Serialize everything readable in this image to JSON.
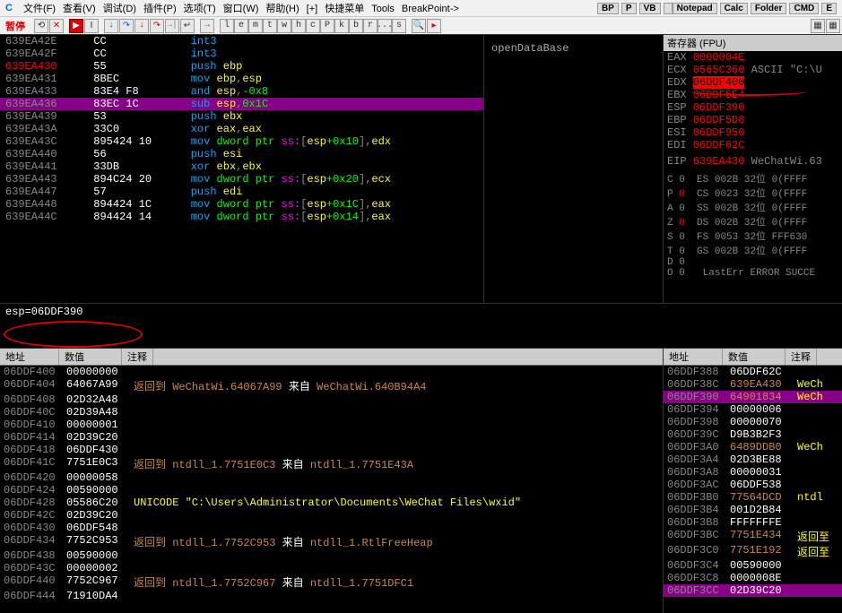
{
  "menu": [
    "文件(F)",
    "查看(V)",
    "调试(D)",
    "插件(P)",
    "选项(T)",
    "窗口(W)",
    "帮助(H)",
    "[+]",
    "快捷菜单",
    "Tools",
    "BreakPoint->"
  ],
  "menu_right": [
    "BP",
    "P",
    "VB",
    "",
    "Notepad",
    "Calc",
    "Folder",
    "CMD",
    "E"
  ],
  "toolbar": {
    "pause": "暂停",
    "letters": [
      "l",
      "e",
      "m",
      "t",
      "w",
      "h",
      "c",
      "P",
      "k",
      "b",
      "r",
      "...",
      "s"
    ]
  },
  "disasm": [
    {
      "addr": "639EA42E",
      "bytes": "CC",
      "mn": "int3",
      "ops": []
    },
    {
      "addr": "639EA42F",
      "bytes": "CC",
      "mn": "int3",
      "ops": []
    },
    {
      "addr": "639EA430",
      "hl": true,
      "bytes": "55",
      "mn": "push",
      "ops": [
        {
          "t": "reg",
          "v": "ebp"
        }
      ]
    },
    {
      "addr": "639EA431",
      "bytes": "8BEC",
      "mn": "mov",
      "ops": [
        {
          "t": "reg",
          "v": "ebp"
        },
        {
          "t": "comma"
        },
        {
          "t": "reg",
          "v": "esp"
        }
      ]
    },
    {
      "addr": "639EA433",
      "bytes": "83E4 F8",
      "mn": "and",
      "ops": [
        {
          "t": "reg",
          "v": "esp"
        },
        {
          "t": "comma"
        },
        {
          "t": "num",
          "v": "-0x8"
        }
      ]
    },
    {
      "addr": "639EA436",
      "sel": true,
      "bytes": "83EC 1C",
      "mn": "sub",
      "ops": [
        {
          "t": "reg",
          "v": "esp"
        },
        {
          "t": "comma"
        },
        {
          "t": "num",
          "v": "0x1C"
        }
      ]
    },
    {
      "addr": "639EA439",
      "bytes": "53",
      "mn": "push",
      "ops": [
        {
          "t": "reg",
          "v": "ebx"
        }
      ]
    },
    {
      "addr": "639EA43A",
      "bytes": "33C0",
      "mn": "xor",
      "ops": [
        {
          "t": "reg",
          "v": "eax"
        },
        {
          "t": "comma"
        },
        {
          "t": "reg",
          "v": "eax"
        }
      ]
    },
    {
      "addr": "639EA43C",
      "bytes": "895424 10",
      "mn": "mov",
      "ops": [
        {
          "t": "ptr",
          "v": "dword ptr "
        },
        {
          "t": "seg",
          "v": "ss"
        },
        {
          "t": "txt",
          "v": ":["
        },
        {
          "t": "reg",
          "v": "esp"
        },
        {
          "t": "num",
          "v": "+0x10"
        },
        {
          "t": "txt",
          "v": "],"
        },
        {
          "t": "reg",
          "v": "edx"
        }
      ]
    },
    {
      "addr": "639EA440",
      "bytes": "56",
      "mn": "push",
      "ops": [
        {
          "t": "reg",
          "v": "esi"
        }
      ]
    },
    {
      "addr": "639EA441",
      "bytes": "33DB",
      "mn": "xor",
      "ops": [
        {
          "t": "reg",
          "v": "ebx"
        },
        {
          "t": "comma"
        },
        {
          "t": "reg",
          "v": "ebx"
        }
      ]
    },
    {
      "addr": "639EA443",
      "bytes": "894C24 20",
      "mn": "mov",
      "ops": [
        {
          "t": "ptr",
          "v": "dword ptr "
        },
        {
          "t": "seg",
          "v": "ss"
        },
        {
          "t": "txt",
          "v": ":["
        },
        {
          "t": "reg",
          "v": "esp"
        },
        {
          "t": "num",
          "v": "+0x20"
        },
        {
          "t": "txt",
          "v": "],"
        },
        {
          "t": "reg",
          "v": "ecx"
        }
      ]
    },
    {
      "addr": "639EA447",
      "bytes": "57",
      "mn": "push",
      "ops": [
        {
          "t": "reg",
          "v": "edi"
        }
      ]
    },
    {
      "addr": "639EA448",
      "bytes": "894424 1C",
      "mn": "mov",
      "ops": [
        {
          "t": "ptr",
          "v": "dword ptr "
        },
        {
          "t": "seg",
          "v": "ss"
        },
        {
          "t": "txt",
          "v": ":["
        },
        {
          "t": "reg",
          "v": "esp"
        },
        {
          "t": "num",
          "v": "+0x1C"
        },
        {
          "t": "txt",
          "v": "],"
        },
        {
          "t": "reg",
          "v": "eax"
        }
      ]
    },
    {
      "addr": "639EA44C",
      "bytes": "894424 14",
      "mn": "mov",
      "ops": [
        {
          "t": "ptr",
          "v": "dword ptr "
        },
        {
          "t": "seg",
          "v": "ss"
        },
        {
          "t": "txt",
          "v": ":["
        },
        {
          "t": "reg",
          "v": "esp"
        },
        {
          "t": "num",
          "v": "+0x14"
        },
        {
          "t": "txt",
          "v": "],"
        },
        {
          "t": "reg",
          "v": "eax"
        }
      ]
    }
  ],
  "info": "openDataBase",
  "registers": {
    "title": "寄存器 (FPU)",
    "rows": [
      {
        "n": "EAX",
        "v": "0000004E",
        "c": ""
      },
      {
        "n": "ECX",
        "v": "0565C360",
        "c": "ASCII \"C:\\U"
      },
      {
        "n": "EDX",
        "v": "06DDF400",
        "hl": true,
        "c": ""
      },
      {
        "n": "EBX",
        "v": "06DDF5E4",
        "c": ""
      },
      {
        "n": "ESP",
        "v": "06DDF390",
        "c": ""
      },
      {
        "n": "EBP",
        "v": "06DDF5D8",
        "c": ""
      },
      {
        "n": "ESI",
        "v": "06DDF950",
        "c": ""
      },
      {
        "n": "EDI",
        "v": "06DDF62C",
        "c": ""
      }
    ],
    "eip": {
      "n": "EIP",
      "v": "639EA430",
      "c": "WeChatWi.63"
    },
    "flags": [
      {
        "f": "C",
        "v": "0",
        "s": "ES",
        "sv": "002B",
        "b": "32位",
        "x": "0(FFFF"
      },
      {
        "f": "P",
        "v": "0",
        "red": true,
        "s": "CS",
        "sv": "0023",
        "b": "32位",
        "x": "0(FFFF"
      },
      {
        "f": "A",
        "v": "0",
        "s": "SS",
        "sv": "002B",
        "b": "32位",
        "x": "0(FFFF"
      },
      {
        "f": "Z",
        "v": "0",
        "red": true,
        "s": "DS",
        "sv": "002B",
        "b": "32位",
        "x": "0(FFFF"
      },
      {
        "f": "S",
        "v": "0",
        "s": "FS",
        "sv": "0053",
        "b": "32位",
        "x": "FFF630"
      },
      {
        "f": "T",
        "v": "0",
        "s": "GS",
        "sv": "002B",
        "b": "32位",
        "x": "0(FFFF"
      },
      {
        "f": "D",
        "v": "0",
        "s": "",
        "sv": "",
        "b": "",
        "x": ""
      },
      {
        "f": "O",
        "v": "0",
        "s": "",
        "sv": "LastErr",
        "b": "ERROR",
        "x": "SUCCE"
      }
    ]
  },
  "mid": "esp=06DDF390",
  "dump": {
    "headers": [
      "地址",
      "数值",
      "注释"
    ],
    "rows": [
      {
        "a": "06DDF400",
        "v": "00000000",
        "c": ""
      },
      {
        "a": "06DDF404",
        "v": "64067A99",
        "c": "返回到 WeChatWi.64067A99 来自 WeChatWi.640B94A4",
        "brown": true
      },
      {
        "a": "06DDF408",
        "v": "02D32A48",
        "c": ""
      },
      {
        "a": "06DDF40C",
        "v": "02D39A48",
        "c": ""
      },
      {
        "a": "06DDF410",
        "v": "00000001",
        "c": ""
      },
      {
        "a": "06DDF414",
        "v": "02D39C20",
        "c": ""
      },
      {
        "a": "06DDF418",
        "v": "06DDF430",
        "c": ""
      },
      {
        "a": "06DDF41C",
        "v": "7751E0C3",
        "c": "返回到 ntdll_1.7751E0C3 来自 ntdll_1.7751E43A",
        "brown": true
      },
      {
        "a": "06DDF420",
        "v": "00000058",
        "c": ""
      },
      {
        "a": "06DDF424",
        "v": "00590000",
        "c": ""
      },
      {
        "a": "06DDF428",
        "v": "05586C20",
        "c": "UNICODE \"C:\\Users\\Administrator\\Documents\\WeChat Files\\wxid\""
      },
      {
        "a": "06DDF42C",
        "v": "02D39C20",
        "c": ""
      },
      {
        "a": "06DDF430",
        "v": "06DDF548",
        "c": ""
      },
      {
        "a": "06DDF434",
        "v": "7752C953",
        "c": "返回到 ntdll_1.7752C953 来自 ntdll_1.RtlFreeHeap",
        "brown": true
      },
      {
        "a": "06DDF438",
        "v": "00590000",
        "c": ""
      },
      {
        "a": "06DDF43C",
        "v": "00000002",
        "c": ""
      },
      {
        "a": "06DDF440",
        "v": "7752C967",
        "c": "返回到 ntdll_1.7752C967 来自 ntdll_1.7751DFC1",
        "brown": true
      },
      {
        "a": "06DDF444",
        "v": "71910DA4",
        "c": ""
      }
    ]
  },
  "stack": {
    "headers": [
      "地址",
      "数值",
      "注释"
    ],
    "rows": [
      {
        "a": "06DDF388",
        "v": "06DDF62C",
        "c": ""
      },
      {
        "a": "06DDF38C",
        "v": "639EA430",
        "c": "WeCh",
        "brown": true
      },
      {
        "a": "06DDF390",
        "sel": true,
        "v": "64901834",
        "c": "WeCh",
        "brown": true
      },
      {
        "a": "06DDF394",
        "v": "00000006",
        "c": ""
      },
      {
        "a": "06DDF398",
        "v": "00000070",
        "c": ""
      },
      {
        "a": "06DDF39C",
        "v": "D9B3B2F3",
        "c": ""
      },
      {
        "a": "06DDF3A0",
        "v": "6489DDB0",
        "c": "WeCh",
        "brown": true
      },
      {
        "a": "06DDF3A4",
        "v": "02D3BE88",
        "c": ""
      },
      {
        "a": "06DDF3A8",
        "v": "00000031",
        "c": ""
      },
      {
        "a": "06DDF3AC",
        "v": "06DDF538",
        "c": ""
      },
      {
        "a": "06DDF3B0",
        "v": "77564DCD",
        "c": "ntdl",
        "brown": true
      },
      {
        "a": "06DDF3B4",
        "v": "001D2B84",
        "c": ""
      },
      {
        "a": "06DDF3B8",
        "v": "FFFFFFFE",
        "c": ""
      },
      {
        "a": "06DDF3BC",
        "v": "7751E434",
        "c": "返回至",
        "brown": true
      },
      {
        "a": "06DDF3C0",
        "v": "7751E192",
        "c": "返回至",
        "brown": true
      },
      {
        "a": "06DDF3C4",
        "v": "00590000",
        "c": ""
      },
      {
        "a": "06DDF3C8",
        "v": "0000008E",
        "c": ""
      },
      {
        "a": "06DDF3CC",
        "sel": true,
        "v": "02D39C20",
        "c": ""
      }
    ]
  }
}
